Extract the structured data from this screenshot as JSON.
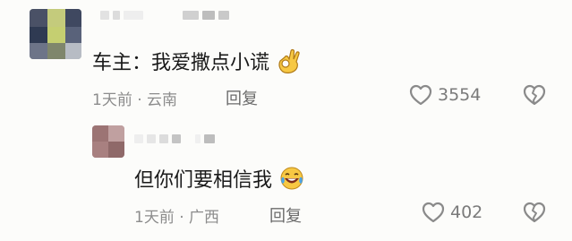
{
  "comments": [
    {
      "author": "车主：",
      "text": "我爱撒点小谎",
      "emoji_icon": "ok-hand-icon",
      "time": "1天前",
      "separator": "·",
      "location": "云南",
      "reply_label": "回复",
      "like_count": "3554"
    },
    {
      "text": "但你们要相信我",
      "emoji_icon": "laughing-tears-icon",
      "time": "1天前",
      "separator": "·",
      "location": "广西",
      "reply_label": "回复",
      "like_count": "402"
    }
  ],
  "colors": {
    "text": "#1a1a1a",
    "meta": "#8c8c8c",
    "icon": "#8a8a8a",
    "background": "#fcfcfa"
  }
}
